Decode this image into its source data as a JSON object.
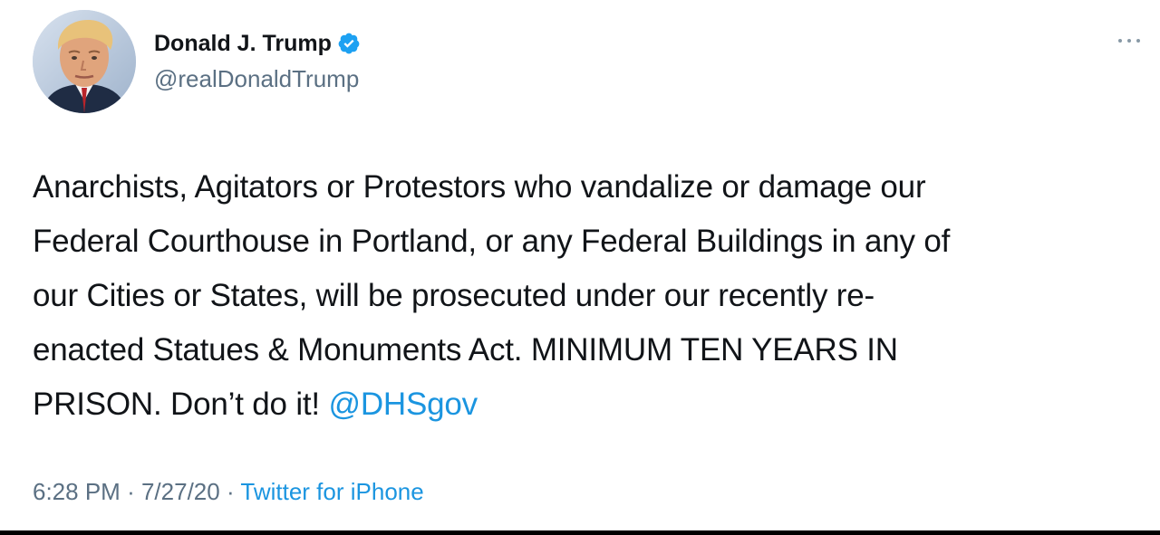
{
  "author": {
    "display_name": "Donald J. Trump",
    "handle": "@realDonaldTrump",
    "avatar_icon": "profile-photo",
    "verified_icon": "verified-badge-icon"
  },
  "tweet": {
    "lines": [
      "Anarchists, Agitators or Protestors who vandalize or damage our",
      "Federal Courthouse in Portland, or any Federal Buildings in any of",
      "our Cities or States, will be prosecuted under our recently re-",
      "enacted Statues & Monuments Act. MINIMUM TEN YEARS IN",
      "PRISON. Don’t do it!"
    ],
    "mention": "@DHSgov"
  },
  "meta": {
    "time": "6:28 PM",
    "separator": "·",
    "date": "7/27/20",
    "source": "Twitter for iPhone"
  },
  "colors": {
    "link": "#1b95e0",
    "secondary_text": "#5b7083",
    "verified": "#1da1f2"
  }
}
